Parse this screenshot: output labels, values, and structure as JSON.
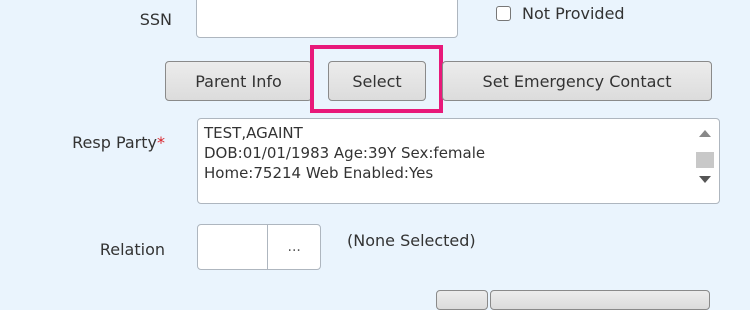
{
  "fields": {
    "ssn_label": "SSN",
    "not_provided_label": "Not Provided",
    "resp_party_label": "Resp Party",
    "required_marker": "*",
    "relation_label": "Relation",
    "relation_status": "(None Selected)",
    "ellipsis": "..."
  },
  "buttons": {
    "parent_info": "Parent Info",
    "select": "Select",
    "set_emergency_contact": "Set Emergency Contact"
  },
  "resp_party": {
    "lines": [
      "TEST,AGAINT",
      "DOB:01/01/1983 Age:39Y  Sex:female",
      "Home:75214 Web Enabled:Yes"
    ]
  },
  "colors": {
    "background": "#eaf4fd",
    "highlight": "#e8197a",
    "required": "#d9222a"
  }
}
